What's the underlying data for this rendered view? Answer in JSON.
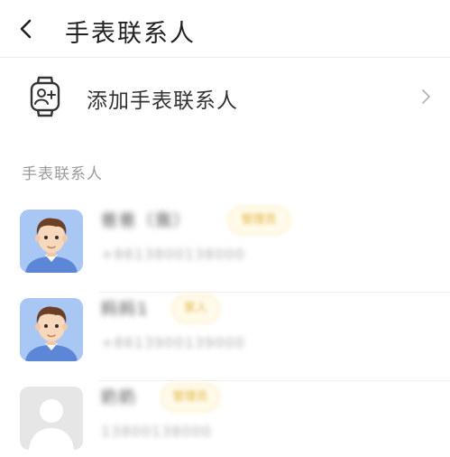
{
  "header": {
    "title": "手表联系人"
  },
  "add_contact": {
    "label": "添加手表联系人"
  },
  "section": {
    "title": "手表联系人"
  },
  "contacts": [
    {
      "name": "爸爸（我）",
      "badge": "管理员",
      "phone": "+8613800138000",
      "avatar": "boy-avatar"
    },
    {
      "name": "妈妈1",
      "badge": "家人",
      "phone": "+8613900139000",
      "avatar": "boy-avatar"
    },
    {
      "name": "奶奶",
      "badge": "管理员",
      "phone": "13800138000",
      "avatar": "default-user-avatar"
    }
  ],
  "colors": {
    "badge_text": "#e3b63a",
    "badge_bg": "#fffaea",
    "avatar_bg": "#a9c7f4"
  }
}
